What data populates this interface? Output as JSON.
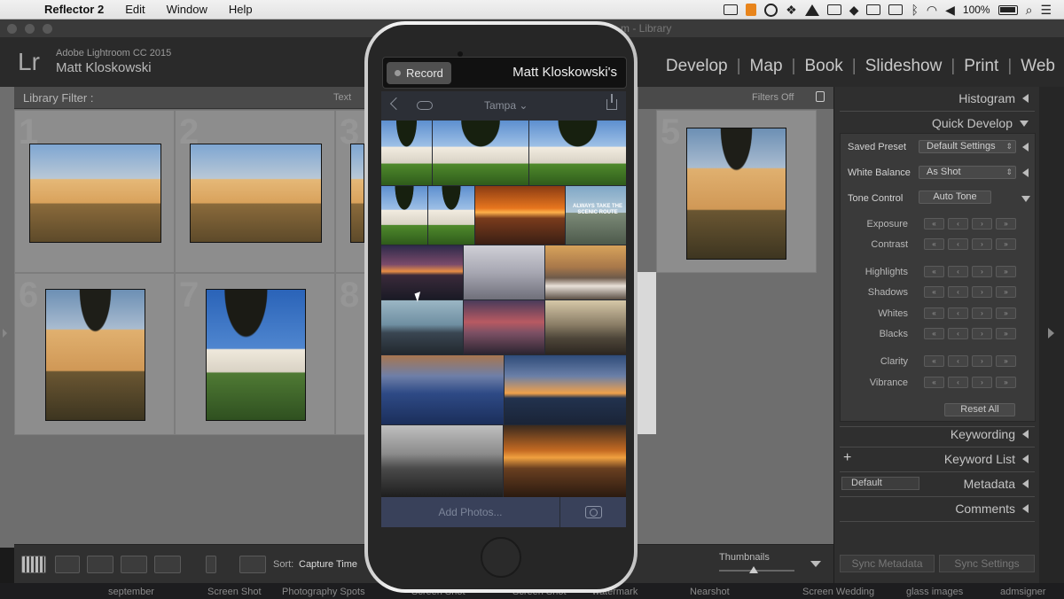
{
  "mac_menubar": {
    "app_name": "Reflector 2",
    "menus": [
      "Edit",
      "Window",
      "Help"
    ],
    "battery": "100%"
  },
  "window": {
    "title": "m - Library"
  },
  "lightroom": {
    "version": "Adobe Lightroom CC 2015",
    "user": "Matt Kloskowski",
    "logo": "Lr",
    "modules": [
      "Develop",
      "Map",
      "Book",
      "Slideshow",
      "Print",
      "Web"
    ],
    "library_filter": "Library Filter :",
    "filter_text": "Text",
    "filters_off": "Filters Off",
    "grid_numbers": [
      "1",
      "2",
      "3",
      "5",
      "6",
      "7",
      "8"
    ],
    "toolbar": {
      "sort_label": "Sort:",
      "sort_value": "Capture Time",
      "thumbnails_label": "Thumbnails"
    },
    "right_panel": {
      "histogram": "Histogram",
      "quick_develop": "Quick Develop",
      "saved_preset_label": "Saved Preset",
      "saved_preset_value": "Default Settings",
      "white_balance_label": "White Balance",
      "white_balance_value": "As Shot",
      "tone_control_label": "Tone Control",
      "auto_tone": "Auto Tone",
      "adjustments": [
        "Exposure",
        "Contrast",
        "Highlights",
        "Shadows",
        "Whites",
        "Blacks",
        "Clarity",
        "Vibrance"
      ],
      "reset_all": "Reset All",
      "keywording": "Keywording",
      "keyword_list": "Keyword List",
      "metadata": "Metadata",
      "metadata_preset": "Default",
      "comments": "Comments",
      "sync_metadata": "Sync Metadata",
      "sync_settings": "Sync Settings"
    }
  },
  "phone": {
    "record_label": "Record",
    "device_name": "Matt Kloskowski's",
    "album_name": "Tampa",
    "scenic_text": "ALWAYS TAKE THE SCENIC ROUTE",
    "add_photos": "Add Photos..."
  },
  "dock": {
    "labels": [
      "september",
      "Screen Shot",
      "Photography Spots",
      "Screen Shot",
      "Screen Shot",
      "watermark",
      "Nearshot",
      "Screen Wedding",
      "glass images",
      "admsigner"
    ]
  },
  "colors": {
    "lr_background": "#2a2a2a",
    "grid_background": "#6e6e6e",
    "panel_background": "#2f2f2f",
    "phone_screen": "#262a33",
    "add_photos_bar": "#39415a"
  }
}
